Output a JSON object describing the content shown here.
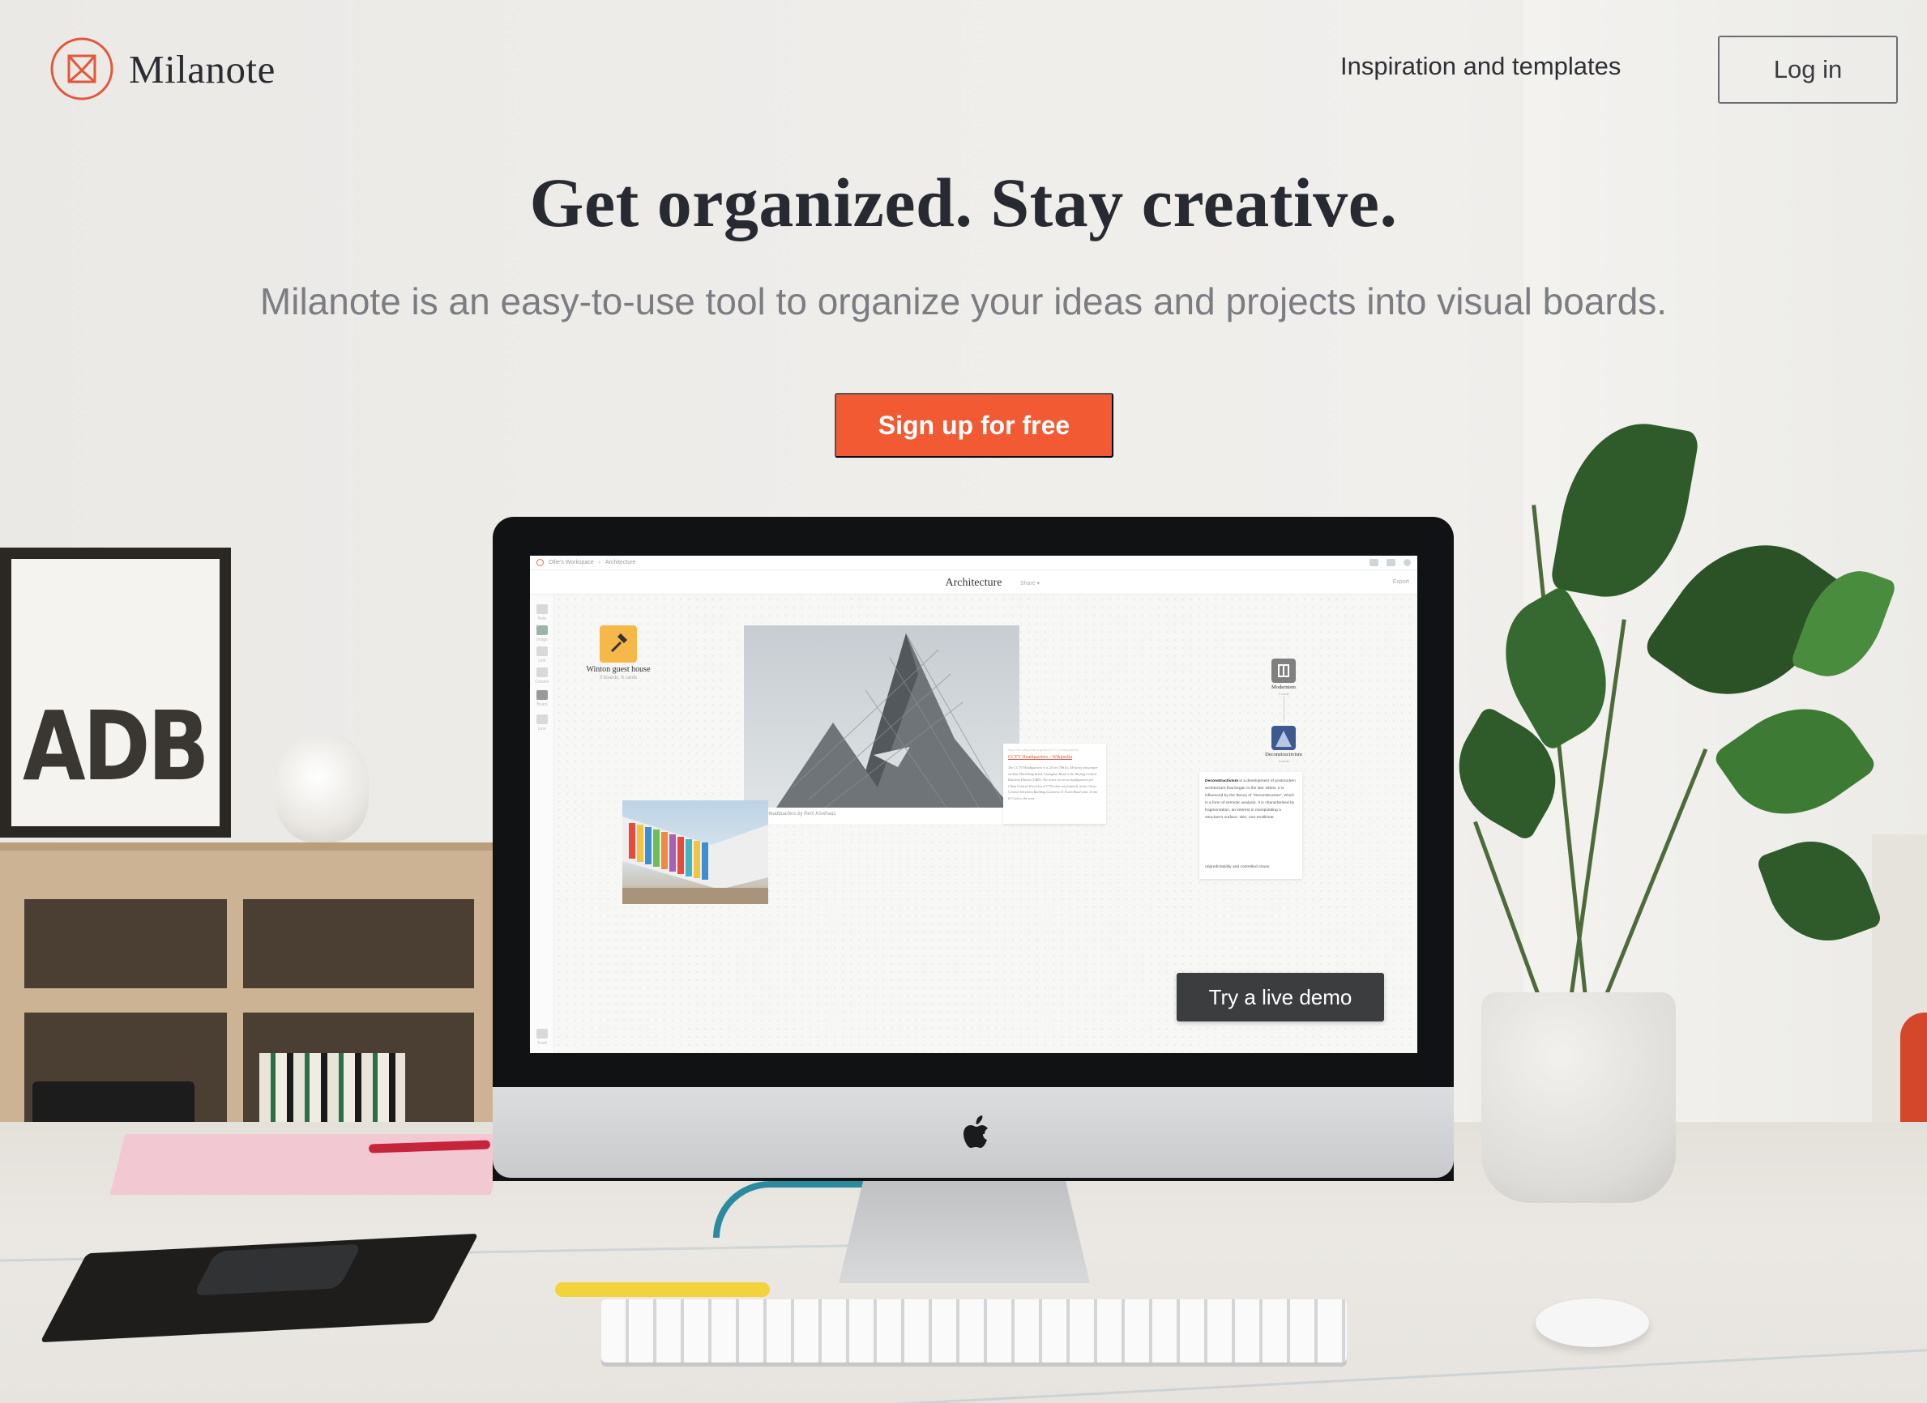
{
  "header": {
    "logo_text": "Milanote",
    "nav_link": "Inspiration and templates",
    "login_label": "Log in"
  },
  "hero": {
    "headline": "Get organized. Stay creative.",
    "subhead": "Milanote is an easy-to-use tool to organize your ideas and projects into visual boards.",
    "cta_label": "Sign up for free"
  },
  "app_preview": {
    "breadcrumb_workspace": "Ollie's Workspace",
    "breadcrumb_board": "Architecture",
    "board_title": "Architecture",
    "share_label": "Share ▾",
    "export_label": "Export",
    "toolbar": [
      "Note",
      "Image",
      "Link",
      "Column",
      "Board",
      "Line"
    ],
    "trash_label": "Trash",
    "cards": {
      "board_winton": {
        "title": "Winton guest house",
        "meta": "3 boards, 6 cards"
      },
      "board_modernism": {
        "title": "Modernism",
        "meta": "3 cards"
      },
      "board_decon": {
        "title": "Deconstructivism",
        "meta": "4 cards"
      },
      "image_caption": "CCTV Headquarters by Rem Koolhaas",
      "wiki_url": "https://en.wikipedia.org/wiki/CCTV_Headquarters",
      "wiki_title": "CCTV Headquarters - Wikipedia",
      "wiki_body": "The CCTV Headquarters is a 234 m (768 ft), 44-storey skyscraper on East Third Ring Road, Guanghua Road in the Beijing Central Business District (CBD). The tower serves as headquarters for China Central Television (CCTV) that was formerly at the China Central Television Building located at 11 Fuxin Road some 15 km (9.3 mi) to the west.",
      "text_card_bold": "Deconstructivism",
      "text_card_body": " is a development of postmodern architecture that began in the late 1950s. It is influenced by the theory of \"Deconstruction\", which is a form of semiotic analysis. It is characterised by fragmentation, an interest in manipulating a structure's surface, skin, non-rectilinear",
      "text_card_tail": "unpredictability and controlled chaos."
    },
    "demo_label": "Try a live demo"
  },
  "background": {
    "poster_text": "ADB"
  },
  "colors": {
    "brand_orange": "#f15a33",
    "text_dark": "#282a31",
    "text_muted": "#7b7d82",
    "demo_button": "#3c3d3f"
  }
}
